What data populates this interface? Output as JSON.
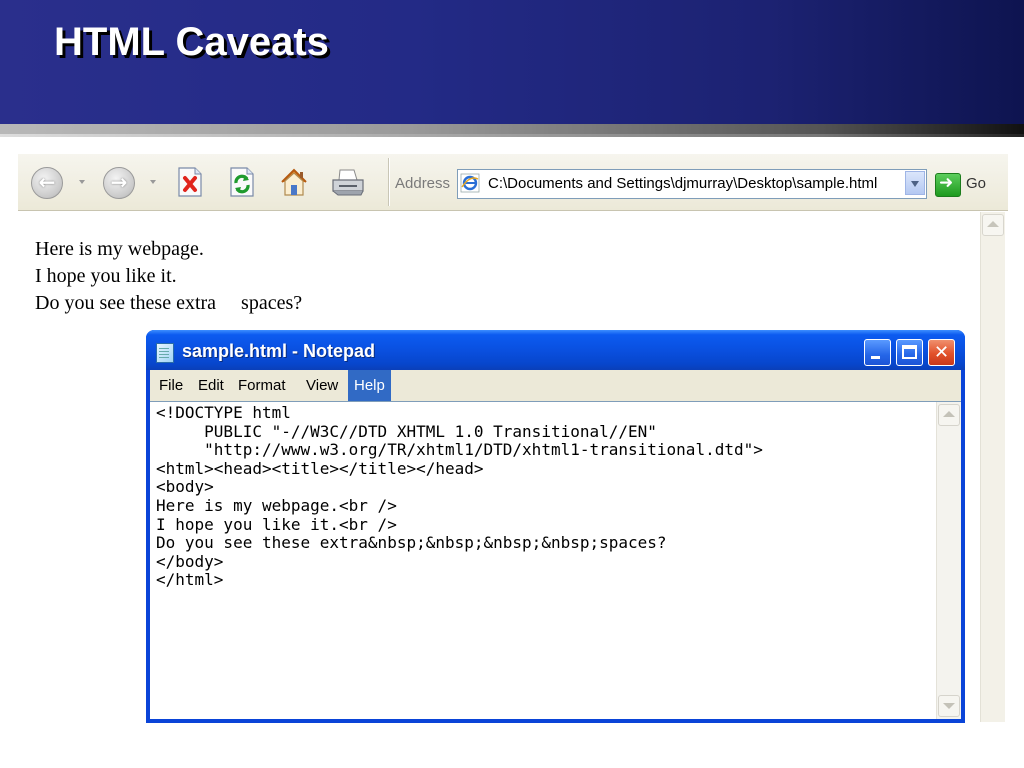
{
  "slide": {
    "title": "HTML Caveats"
  },
  "browser": {
    "toolbar": {
      "back_icon": "back-arrow-icon",
      "forward_icon": "forward-arrow-icon",
      "stop_icon": "stop-icon",
      "refresh_icon": "refresh-icon",
      "home_icon": "home-icon",
      "print_icon": "print-icon"
    },
    "address": {
      "label": "Address",
      "value": "C:\\Documents and Settings\\djmurray\\Desktop\\sample.html",
      "go_label": "Go"
    },
    "page": {
      "lines": [
        "Here is my webpage.",
        "I hope you like it.",
        "Do you see these extra     spaces?"
      ]
    }
  },
  "notepad": {
    "title": "sample.html - Notepad",
    "menu": [
      "File",
      "Edit",
      "Format",
      "View",
      "Help"
    ],
    "active_menu": "Help",
    "code": "<!DOCTYPE html\n     PUBLIC \"-//W3C//DTD XHTML 1.0 Transitional//EN\"\n     \"http://www.w3.org/TR/xhtml1/DTD/xhtml1-transitional.dtd\">\n<html><head><title></title></head>\n<body>\nHere is my webpage.<br />\nI hope you like it.<br />\nDo you see these extra&nbsp;&nbsp;&nbsp;&nbsp;spaces?\n</body>\n</html>"
  },
  "colors": {
    "slide_header": "#232a86",
    "xp_titlebar": "#0a50e0",
    "menu_highlight": "#316ac5"
  }
}
